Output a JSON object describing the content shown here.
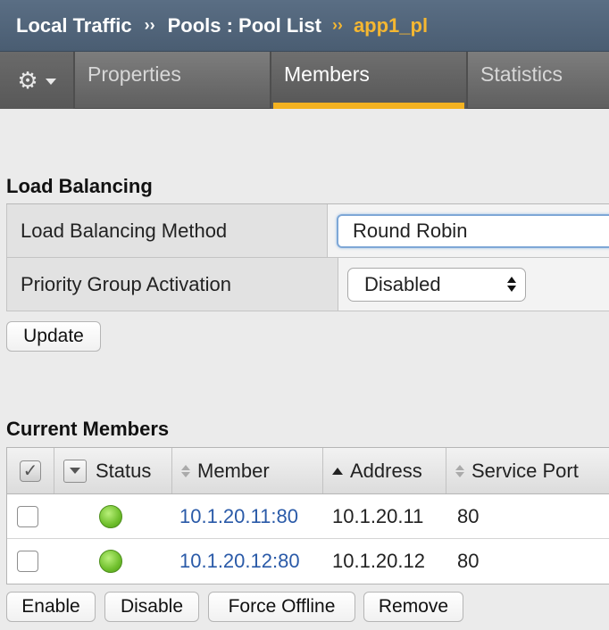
{
  "breadcrumb": {
    "part1": "Local Traffic",
    "sep1": "››",
    "part2": "Pools : Pool List",
    "sep2": "››",
    "current": "app1_pl"
  },
  "tabs": [
    {
      "label": "Properties",
      "active": false
    },
    {
      "label": "Members",
      "active": true
    },
    {
      "label": "Statistics",
      "active": false
    }
  ],
  "load_balancing": {
    "title": "Load Balancing",
    "rows": [
      {
        "label": "Load Balancing Method",
        "value": "Round Robin"
      },
      {
        "label": "Priority Group Activation",
        "value": "Disabled"
      }
    ],
    "update_label": "Update"
  },
  "members": {
    "title": "Current Members",
    "columns": {
      "status": "Status",
      "member": "Member",
      "address": "Address",
      "port": "Service Port"
    },
    "rows": [
      {
        "member": "10.1.20.11:80",
        "address": "10.1.20.11",
        "port": "80",
        "status_color": "#6fbf2c"
      },
      {
        "member": "10.1.20.12:80",
        "address": "10.1.20.12",
        "port": "80",
        "status_color": "#6fbf2c"
      }
    ],
    "buttons": {
      "enable": "Enable",
      "disable": "Disable",
      "force_offline": "Force Offline",
      "remove": "Remove"
    }
  },
  "colors": {
    "accent": "#f3b221",
    "header": "#4f6378",
    "link": "#2a5aa8"
  }
}
